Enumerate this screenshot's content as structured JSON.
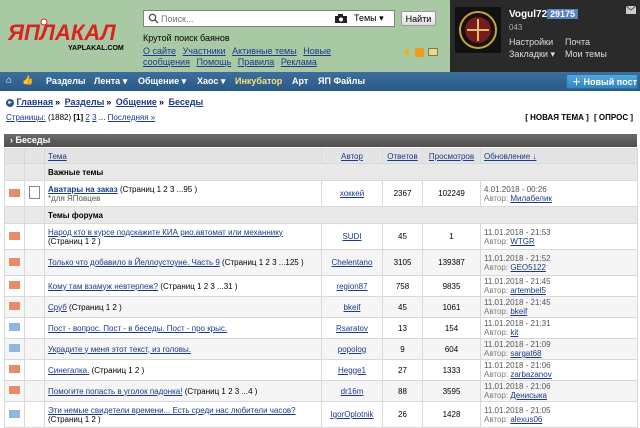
{
  "header": {
    "logo_text": "ЯПЛАКАЛ",
    "logo_sub": "YAPLAKAL.COM",
    "search_placeholder": "Поиск...",
    "search_scope": "Темы",
    "search_button": "Найти",
    "tagline": "Крутой поиск баянов",
    "links": [
      "О сайте",
      "Участники",
      "Активные темы",
      "Новые сообщения",
      "Помощь",
      "Правила",
      "Реклама"
    ]
  },
  "user": {
    "name": "Vogul72",
    "count": "29175",
    "num": "043",
    "settings": "Настройки",
    "mail": "Почта",
    "bookmarks": "Закладки",
    "my_topics": "Мои темы"
  },
  "nav": {
    "items": [
      "Разделы",
      "Лента",
      "Общение",
      "Хаос",
      "Инкубатор",
      "Арт",
      "ЯП Файлы"
    ],
    "new_post": "Новый пост"
  },
  "breadcrumbs": [
    "Главная",
    "Разделы",
    "Общение",
    "Беседы"
  ],
  "pagination": {
    "label": "Страницы:",
    "count": "(1882)",
    "current": "[1]",
    "pages": [
      "2",
      "3"
    ],
    "ellipsis": "...",
    "last": "Последняя »"
  },
  "actions": {
    "new_topic": "[ НОВАЯ ТЕМА ]",
    "poll": "[ ОПРОС ]"
  },
  "forum_title": "Беседы",
  "columns": {
    "topic": "Тема",
    "author": "Автор",
    "replies": "Ответов",
    "views": "Просмотров",
    "updated": "Обновление ↓"
  },
  "groups": {
    "important": "Важные темы",
    "forum": "Темы форума"
  },
  "pinned": {
    "title": "Аватары на заказ",
    "pages": "(Страниц 1 2 3 ...95 )",
    "sub": "*для ЯПовцев",
    "author": "хоккей",
    "replies": "2367",
    "views": "102249",
    "date": "4.01.2018 - 00:26",
    "last_label": "Автор:",
    "last_user": "Милабелик"
  },
  "topics": [
    {
      "title": "Народ кто в курсе подскажите КИА рио.автомат или механнику",
      "pages": "(Страниц 1 2 )",
      "author": "SUDI",
      "replies": "45",
      "views": "1",
      "date": "11.01.2018 - 21:53",
      "last_user": "WTGR"
    },
    {
      "title": "Только что добавило в Йеллоустоуне. Часть 9",
      "pages": "(Страниц 1 2 3 ...125 )",
      "author": "Chelentano",
      "replies": "3105",
      "views": "139387",
      "date": "11.01.2018 - 21:52",
      "last_user": "GEO5122"
    },
    {
      "title": "Кому там взамуж невтерпеж?",
      "pages": "(Страниц 1 2 3 ...31 )",
      "author": "region87",
      "replies": "758",
      "views": "9835",
      "date": "11.01.2018 - 21:45",
      "last_user": "artembel5"
    },
    {
      "title": "Сруб",
      "pages": "(Страниц 1 2 )",
      "author": "bkeif",
      "replies": "45",
      "views": "1061",
      "date": "11.01.2018 - 21:45",
      "last_user": "bkeif"
    },
    {
      "title": "Пост - вопрос. Пост - в беседы. Пост - про крыс.",
      "pages": "",
      "author": "Rsaratov",
      "replies": "13",
      "views": "154",
      "date": "11.01.2018 - 21:31",
      "last_user": "kit"
    },
    {
      "title": "Украдите у меня этот текст, из головы.",
      "pages": "",
      "author": "popolog",
      "replies": "9",
      "views": "604",
      "date": "11.01.2018 - 21:09",
      "last_user": "sargat68"
    },
    {
      "title": "Синегалка.",
      "pages": "(Страниц 1 2 )",
      "author": "Hegge1",
      "replies": "27",
      "views": "1333",
      "date": "11.01.2018 - 21:06",
      "last_user": "zarbazanov"
    },
    {
      "title": "Помогите попасть в уголок падонка!",
      "pages": "(Страниц 1 2 3 ...4 )",
      "author": "dr16m",
      "replies": "88",
      "views": "3595",
      "date": "11.01.2018 - 21:06",
      "last_user": "Денисыка"
    },
    {
      "title": "Эти немые свидетели времени... Есть среди нас любители часов?",
      "pages": "(Страниц 1 2 )",
      "author": "IgorOplotnik",
      "replies": "26",
      "views": "1428",
      "date": "11.01.2018 - 21:05",
      "last_user": "alexus06"
    }
  ],
  "last_label": "Автор:",
  "colors": {
    "header_bg": "#a9c9a5",
    "nav_bg": "#2a5985",
    "incubator": "#f7e27a",
    "new_post_bg": "#3a94d0",
    "logo_red": "#d9231c",
    "count_badge": "#5580c4"
  },
  "icons": [
    "search-icon",
    "camera-icon",
    "star-icon",
    "rss-icon",
    "envelope-icon",
    "arrow-icon",
    "chevron-down-icon",
    "plus-icon",
    "home-icon",
    "thumb-icon"
  ]
}
